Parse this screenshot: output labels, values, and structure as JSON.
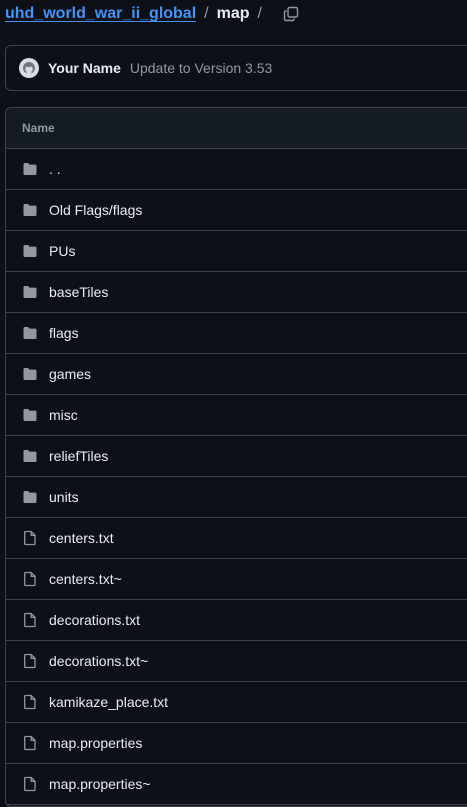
{
  "breadcrumb": {
    "repo": "uhd_world_war_ii_global",
    "separator": "/",
    "current": "map"
  },
  "commit": {
    "author": "Your Name",
    "message": "Update to Version 3.53"
  },
  "table": {
    "header": "Name",
    "rows": [
      {
        "type": "folder",
        "name": ". ."
      },
      {
        "type": "folder",
        "name": "Old Flags/flags"
      },
      {
        "type": "folder",
        "name": "PUs"
      },
      {
        "type": "folder",
        "name": "baseTiles"
      },
      {
        "type": "folder",
        "name": "flags"
      },
      {
        "type": "folder",
        "name": "games"
      },
      {
        "type": "folder",
        "name": "misc"
      },
      {
        "type": "folder",
        "name": "reliefTiles"
      },
      {
        "type": "folder",
        "name": "units"
      },
      {
        "type": "file",
        "name": "centers.txt"
      },
      {
        "type": "file",
        "name": "centers.txt~"
      },
      {
        "type": "file",
        "name": "decorations.txt"
      },
      {
        "type": "file",
        "name": "decorations.txt~"
      },
      {
        "type": "file",
        "name": "kamikaze_place.txt"
      },
      {
        "type": "file",
        "name": "map.properties"
      },
      {
        "type": "file",
        "name": "map.properties~"
      }
    ]
  },
  "colors": {
    "background": "#0d1117",
    "link": "#4493f8",
    "border": "#3d444d",
    "muted": "#9198a1",
    "icon": "#9198a1"
  }
}
